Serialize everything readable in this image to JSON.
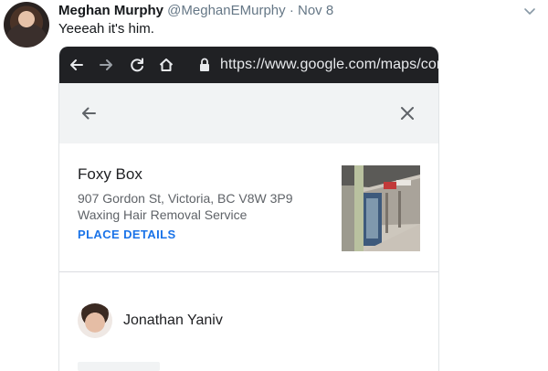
{
  "tweet": {
    "author_name": "Meghan Murphy",
    "handle": "@MeghanEMurphy",
    "separator": "·",
    "date": "Nov 8",
    "text": "Yeeeah it's him."
  },
  "browser": {
    "url": "https://www.google.com/maps/con"
  },
  "place": {
    "name": "Foxy Box",
    "address": "907 Gordon St, Victoria, BC V8W 3P9",
    "category": "Waxing Hair Removal Service",
    "details_link": "PLACE DETAILS"
  },
  "review": {
    "reviewer_name": "Jonathan Yaniv"
  },
  "icons": {
    "caret": "chevron-down-icon",
    "back": "arrow-left-icon",
    "forward": "arrow-right-icon",
    "reload": "reload-icon",
    "home": "home-icon",
    "lock": "lock-icon",
    "close": "close-icon"
  },
  "colors": {
    "link_blue": "#1a73e8",
    "browser_bar": "#202124",
    "panel_header": "#f1f3f4",
    "muted_text": "#657786"
  }
}
